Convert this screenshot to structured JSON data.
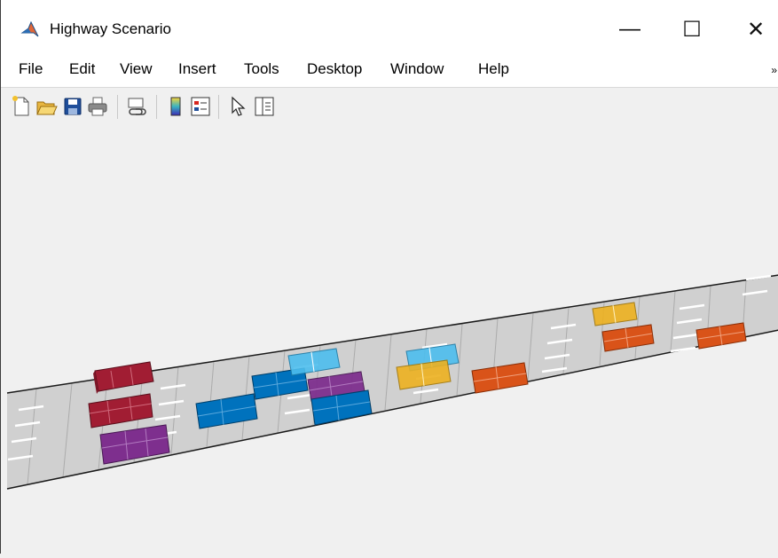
{
  "window": {
    "title": "Highway Scenario",
    "minimize_glyph": "—",
    "maximize_glyph": "☐",
    "close_glyph": "✕"
  },
  "menu": {
    "items": [
      "File",
      "Edit",
      "View",
      "Insert",
      "Tools",
      "Desktop",
      "Window",
      "Help"
    ],
    "overflow_glyph": "»"
  },
  "toolbar": {
    "icons": [
      "new-figure-icon",
      "open-file-icon",
      "save-figure-icon",
      "print-figure-icon",
      "link-plot-icon",
      "insert-colorbar-icon",
      "insert-legend-icon",
      "edit-plot-icon",
      "property-inspector-icon"
    ]
  },
  "scene": {
    "road_color": "#d0d0d0",
    "lane_marking_color": "#ffffff",
    "road_edge_color": "#1a1a1a",
    "vehicle_groups": [
      {
        "name": "crimson",
        "color": "#a11d33",
        "count": 2
      },
      {
        "name": "purple",
        "color": "#7e2f8e",
        "count": 2
      },
      {
        "name": "blue",
        "color": "#0072bd",
        "count": 3
      },
      {
        "name": "light-blue",
        "color": "#4dbeee",
        "count": 2
      },
      {
        "name": "yellow",
        "color": "#edb120",
        "count": 2
      },
      {
        "name": "orange",
        "color": "#d95319",
        "count": 3
      }
    ]
  }
}
